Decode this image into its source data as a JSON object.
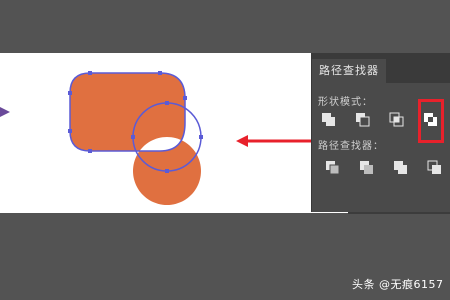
{
  "panel": {
    "tab_label": "路径查找器",
    "shape_modes_label": "形状模式：",
    "pathfinders_label": "路径查找器："
  },
  "shape_modes": [
    {
      "name": "unite",
      "icon": "unite-icon"
    },
    {
      "name": "minus-front",
      "icon": "minus-front-icon"
    },
    {
      "name": "intersect",
      "icon": "intersect-icon"
    },
    {
      "name": "exclude",
      "icon": "exclude-icon",
      "highlighted": true
    }
  ],
  "pathfinders": [
    {
      "name": "divide",
      "icon": "divide-icon"
    },
    {
      "name": "trim",
      "icon": "trim-icon"
    },
    {
      "name": "merge",
      "icon": "merge-icon"
    },
    {
      "name": "crop",
      "icon": "crop-icon"
    }
  ],
  "colors": {
    "shape_fill": "#e07040",
    "selection_path": "#5b5bd6",
    "highlight": "#e8212b",
    "arrow": "#e8212b"
  },
  "watermark": "头条 @无痕6157"
}
